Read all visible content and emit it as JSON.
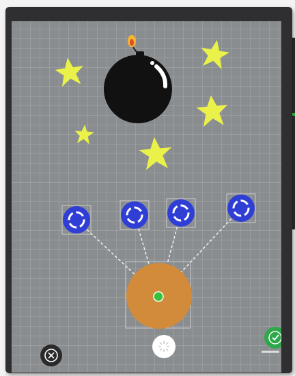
{
  "game": {
    "title": "",
    "colors": {
      "grid_background": "#8a8d90",
      "star": "#eaf24a",
      "bomb": "#111111",
      "fuse_flame": "#f5b52f",
      "anchor": "#2f3fd6",
      "pivot_disc": "#d18b3a",
      "pivot_center": "#39c23a",
      "confirm": "#2ea84a",
      "cancel": "#2a2a2a"
    },
    "stars_count": 5,
    "anchors_count": 4,
    "controls": {
      "cancel_icon": "close-icon",
      "center_icon": "sparkle-icon",
      "confirm_icon": "checkmark-icon"
    }
  }
}
